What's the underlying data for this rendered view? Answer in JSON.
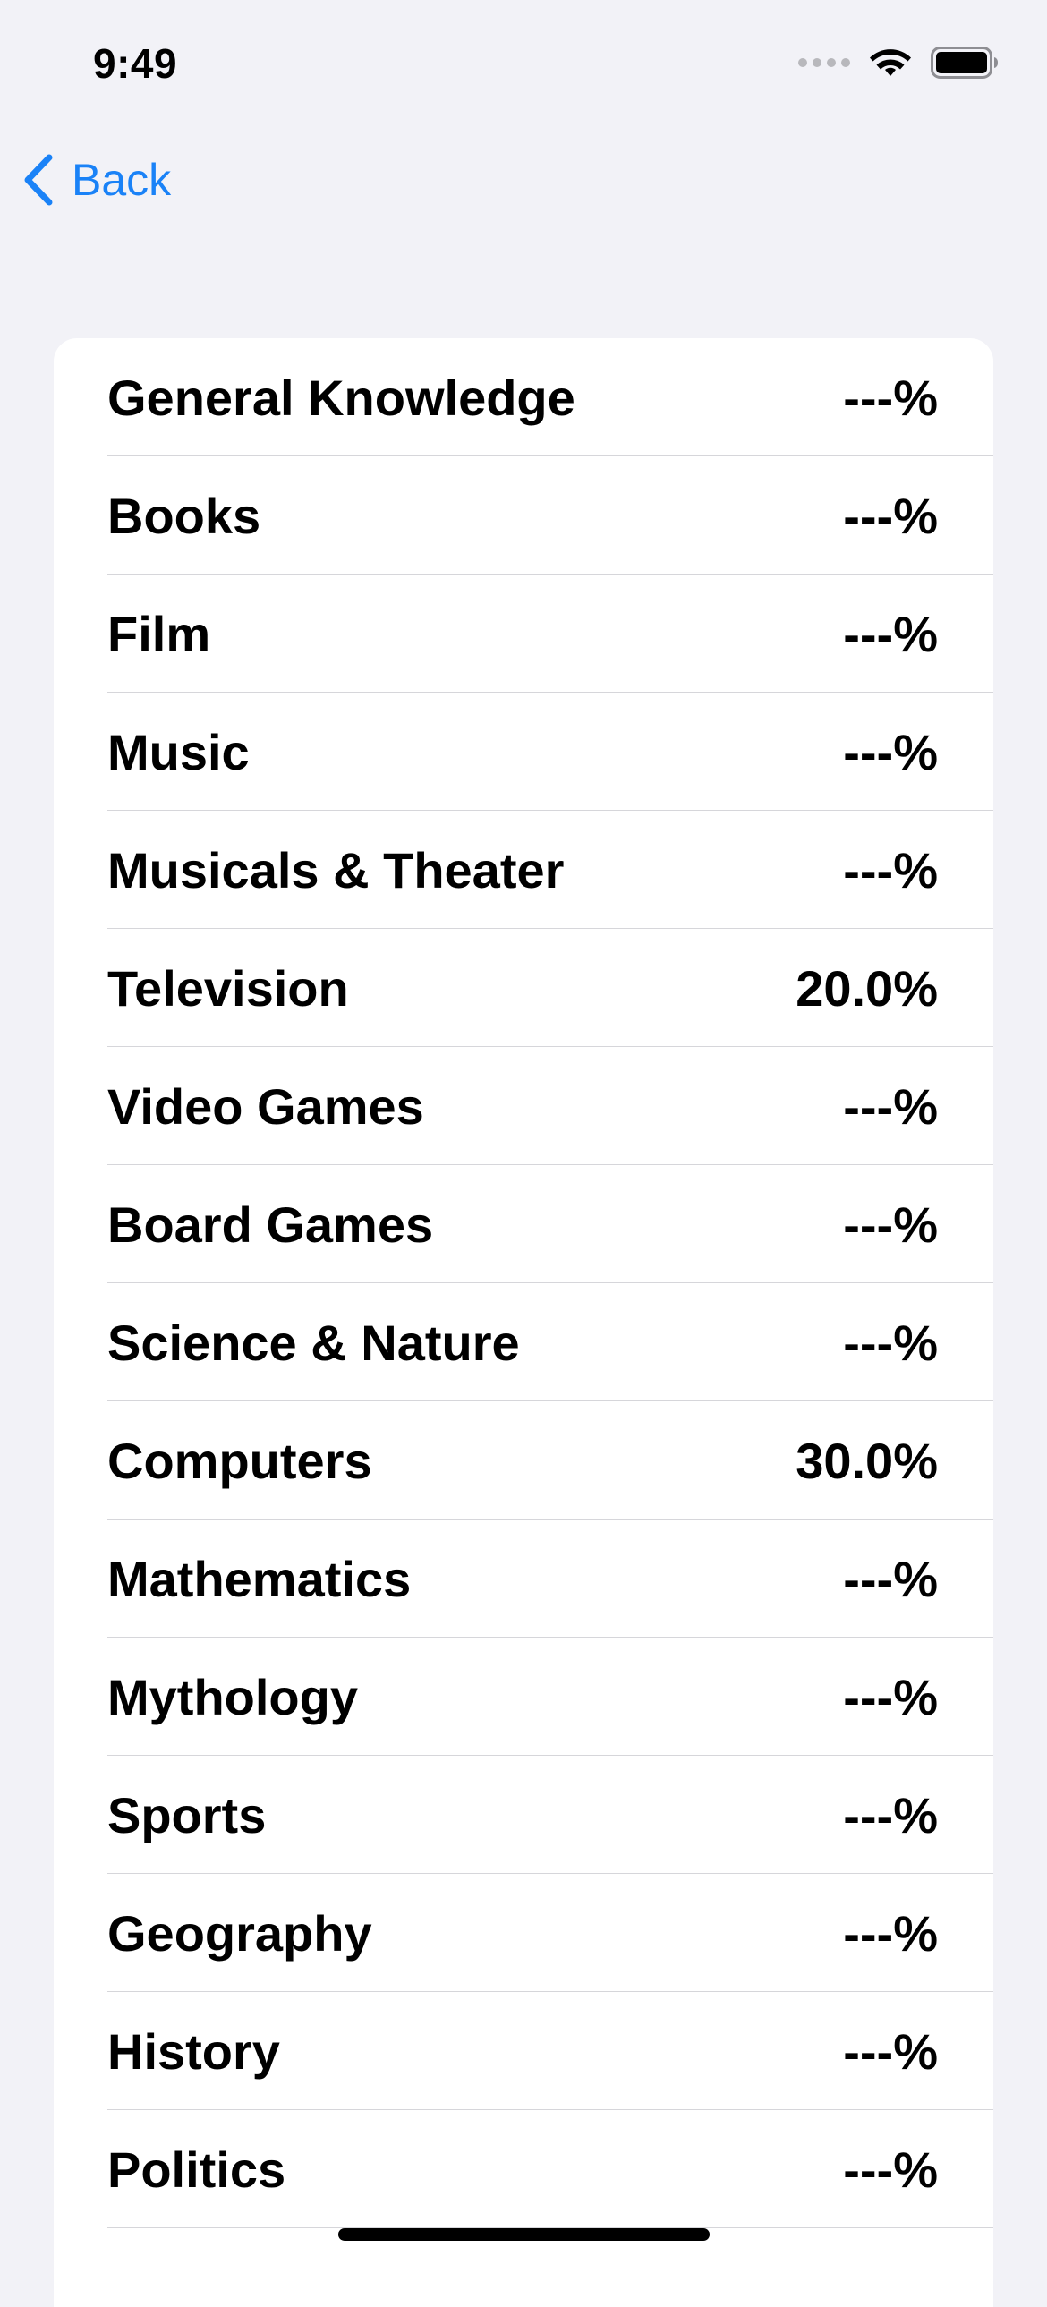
{
  "status_bar": {
    "time": "9:49"
  },
  "nav": {
    "back_label": "Back"
  },
  "categories": [
    {
      "label": "General Knowledge",
      "value": "---%"
    },
    {
      "label": "Books",
      "value": "---%"
    },
    {
      "label": "Film",
      "value": "---%"
    },
    {
      "label": "Music",
      "value": "---%"
    },
    {
      "label": "Musicals & Theater",
      "value": "---%"
    },
    {
      "label": "Television",
      "value": "20.0%"
    },
    {
      "label": "Video Games",
      "value": "---%"
    },
    {
      "label": "Board Games",
      "value": "---%"
    },
    {
      "label": "Science & Nature",
      "value": "---%"
    },
    {
      "label": "Computers",
      "value": "30.0%"
    },
    {
      "label": "Mathematics",
      "value": "---%"
    },
    {
      "label": "Mythology",
      "value": "---%"
    },
    {
      "label": "Sports",
      "value": "---%"
    },
    {
      "label": "Geography",
      "value": "---%"
    },
    {
      "label": "History",
      "value": "---%"
    },
    {
      "label": "Politics",
      "value": "---%"
    }
  ],
  "colors": {
    "accent": "#1a82f7",
    "background": "#f2f2f7",
    "card": "#ffffff",
    "separator": "#d6d6da"
  },
  "icons": {
    "back": "chevron-left-icon",
    "signal": "cellular-signal-icon",
    "wifi": "wifi-icon",
    "battery": "battery-icon"
  }
}
